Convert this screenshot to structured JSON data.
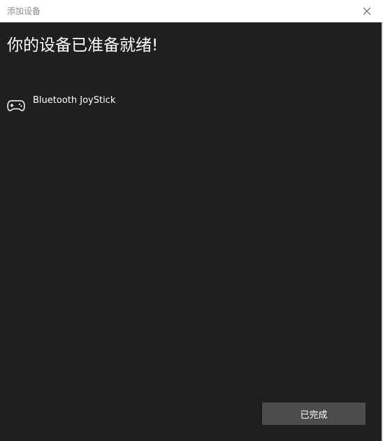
{
  "window": {
    "title": "添加设备",
    "close_icon": "close-icon"
  },
  "main": {
    "heading": "你的设备已准备就绪!",
    "device": {
      "icon": "gamepad-icon",
      "name": "Bluetooth JoyStick"
    },
    "done_button_label": "已完成"
  },
  "colors": {
    "background": "#1f1f1f",
    "button": "#4c4c4c",
    "text": "#ffffff",
    "titlebar": "#ffffff"
  }
}
